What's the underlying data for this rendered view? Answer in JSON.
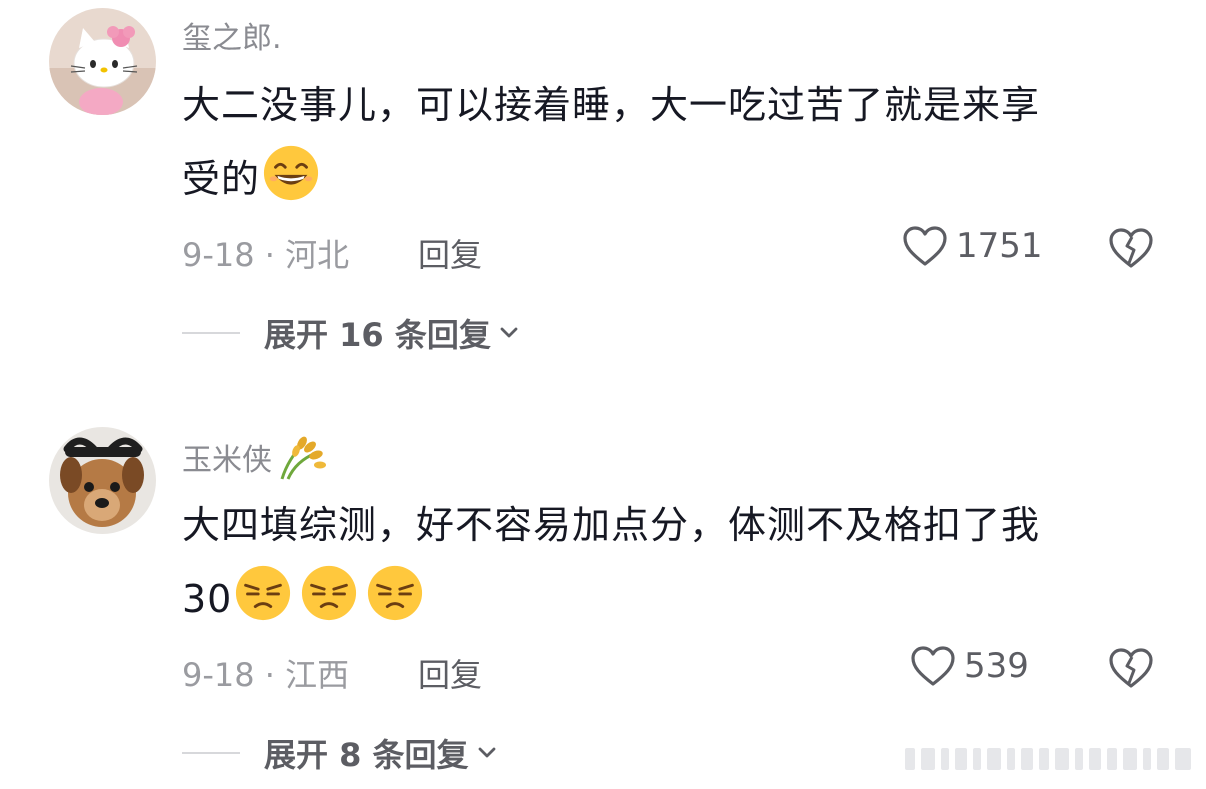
{
  "comments": [
    {
      "username": "玺之郎",
      "username_suffix": ".",
      "text_line1": "大二没事儿，可以接着睡，大一吃过苦了就是来享",
      "text_line2": "受的",
      "emojis": [
        "grinning-face"
      ],
      "date_location": "9-18 · 河北",
      "reply_label": "回复",
      "likes": "1751",
      "expand_label": "展开 16 条回复"
    },
    {
      "username": "玉米侠",
      "username_suffix": "",
      "username_icon": "rice-stalk-icon",
      "text_line1": "大四填综测，好不容易加点分，体测不及格扣了我",
      "text_line2": "30",
      "emojis": [
        "unamused-face",
        "unamused-face",
        "unamused-face"
      ],
      "date_location": "9-18 · 江西",
      "reply_label": "回复",
      "likes": "539",
      "expand_label": "展开 8 条回复"
    }
  ],
  "colors": {
    "text": "#161823",
    "muted": "#9a9ba0",
    "action": "#5c5d63",
    "emoji_yellow": "#ffc83d"
  }
}
